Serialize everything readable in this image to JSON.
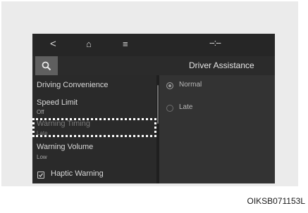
{
  "status_bar": {
    "back_glyph": "<",
    "home_glyph": "⌂",
    "menu_glyph": "≡",
    "status_glyph": "--:--",
    "icons": [
      "back-icon",
      "home-icon",
      "menu-icon"
    ]
  },
  "toolbar": {
    "title": "Driver Assistance",
    "search_icon": "search-icon"
  },
  "menu": {
    "driving_convenience": "Driving Convenience",
    "speed_limit": {
      "label": "Speed Limit",
      "value": "Off"
    },
    "warning_timing": {
      "label": "Warning Timing",
      "value": "Late"
    },
    "warning_volume": {
      "label": "Warning Volume",
      "value": "Low"
    },
    "haptic_warning": {
      "label": "Haptic Warning",
      "checked": true
    }
  },
  "options": {
    "normal": {
      "label": "Normal",
      "selected": true
    },
    "late": {
      "label": "Late",
      "selected": false
    }
  },
  "caption": "OIKSB071153L",
  "colors": {
    "screen_bg": "#3a3a3a",
    "statusbar_bg": "#262626",
    "highlight_border": "#ffffff"
  }
}
